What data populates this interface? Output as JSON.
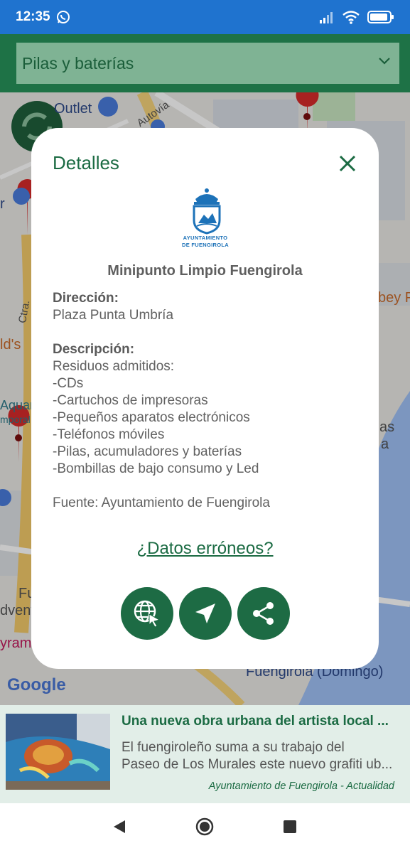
{
  "status_bar": {
    "time": "12:35"
  },
  "header": {
    "category": "Pilas y baterías"
  },
  "map": {
    "labels": [
      "Outlet",
      "Autovía",
      "Ctra.",
      "bey P",
      "as",
      "a",
      "Fu",
      "dvent",
      "yram",
      "Fuengirola (Domingo)",
      "Google",
      "ld's",
      "Aquam",
      "mporal",
      "r"
    ]
  },
  "modal": {
    "title": "Detalles",
    "logo_text": [
      "AYUNTAMIENTO",
      "DE FUENGIROLA"
    ],
    "place_name": "Minipunto Limpio Fuengirola",
    "address_label": "Dirección:",
    "address": "Plaza Punta Umbría",
    "description_label": "Descripción:",
    "description_lines": [
      "Residuos admitidos:",
      "-CDs",
      "-Cartuchos de impresoras",
      "-Pequeños aparatos electrónicos",
      "-Teléfonos móviles",
      "-Pilas, acumuladores y baterías",
      "-Bombillas de bajo consumo y Led"
    ],
    "source": "Fuente: Ayuntamiento de Fuengirola",
    "report_link": "¿Datos erróneos?"
  },
  "news": {
    "title": "Una nueva obra urbana del artista local ...",
    "summary_lines": [
      "El fuengiroleño suma a su trabajo del",
      "Paseo de Los Murales este nuevo grafiti ub..."
    ],
    "source": "Ayuntamiento de Fuengirola - Actualidad"
  },
  "colors": {
    "primary": "#1d6b44",
    "status_bar": "#1f73cf",
    "select_bg": "#7fb394"
  }
}
